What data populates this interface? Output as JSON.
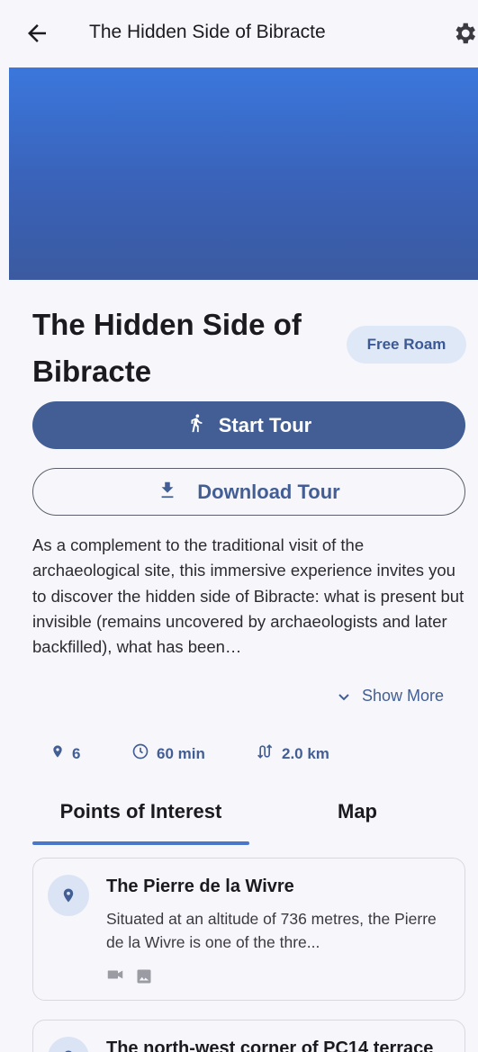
{
  "appbar": {
    "title": "The Hidden Side of Bibracte"
  },
  "tour": {
    "title": "The Hidden Side of Bibracte",
    "mode": "Free Roam",
    "start_label": "Start Tour",
    "download_label": "Download Tour",
    "description": "As a complement to the traditional visit of the archaeological site, this immersive experience invites you to discover the hidden side of Bibracte: what is present but invisible (remains uncovered by archaeologists and later backfilled), what has been…",
    "show_more_label": "Show More"
  },
  "stats": {
    "points": "6",
    "duration": "60 min",
    "distance": "2.0 km"
  },
  "tabs": [
    {
      "label": "Points of Interest",
      "active": true
    },
    {
      "label": "Map",
      "active": false
    }
  ],
  "pois": [
    {
      "title": "The Pierre de la Wivre",
      "text": "Situated at an altitude of 736 metres, the Pierre de la Wivre is one of the thre...",
      "media": [
        "video-icon",
        "image-icon"
      ]
    },
    {
      "title": "The north-west corner of PC14 terrace"
    }
  ],
  "colors": {
    "primary": "#425e94",
    "accent": "#4a77c9",
    "hero_top": "#3b77dc",
    "hero_bottom": "#3b5aa0",
    "chip_bg": "#dfe8f7"
  }
}
